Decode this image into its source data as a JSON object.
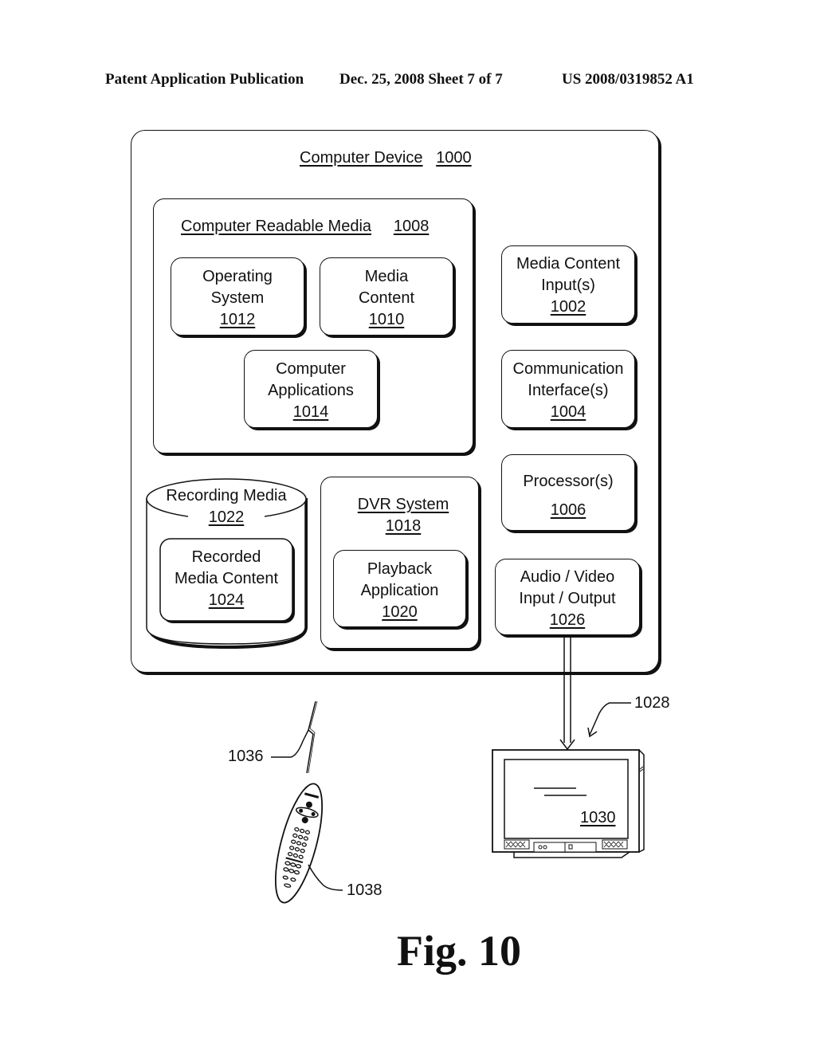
{
  "header": {
    "left": "Patent Application Publication",
    "middle": "Dec. 25, 2008   Sheet 7 of 7",
    "right": "US 2008/0319852 A1"
  },
  "device": {
    "title": "Computer Device",
    "ref": "1000",
    "crm": {
      "title": "Computer Readable Media",
      "ref": "1008",
      "os": {
        "line1": "Operating",
        "line2": "System",
        "ref": "1012"
      },
      "media": {
        "line1": "Media",
        "line2": "Content",
        "ref": "1010"
      },
      "apps": {
        "line1": "Computer",
        "line2": "Applications",
        "ref": "1014"
      }
    },
    "inputs": {
      "line1": "Media Content",
      "line2": "Input(s)",
      "ref": "1002"
    },
    "comm": {
      "line1": "Communication",
      "line2": "Interface(s)",
      "ref": "1004"
    },
    "processor": {
      "line1": "Processor(s)",
      "ref": "1006"
    },
    "av": {
      "line1": "Audio / Video",
      "line2": "Input / Output",
      "ref": "1026"
    },
    "recording": {
      "title": "Recording Media",
      "ref": "1022",
      "recorded": {
        "line1": "Recorded",
        "line2": "Media Content",
        "ref": "1024"
      }
    },
    "dvr": {
      "title": "DVR System",
      "ref": "1018",
      "playback": {
        "line1": "Playback",
        "line2": "Application",
        "ref": "1020"
      }
    }
  },
  "external": {
    "tv_ref": "1028",
    "screen_ref": "1030",
    "signal_ref": "1036",
    "remote_ref": "1038"
  },
  "figure_label": "Fig. 10"
}
